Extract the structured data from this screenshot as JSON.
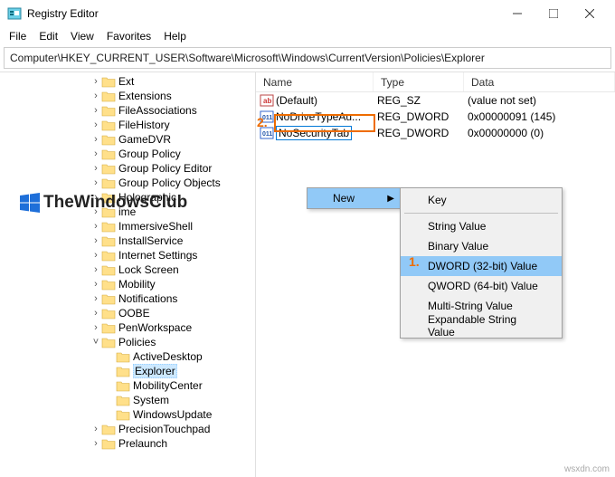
{
  "title": "Registry Editor",
  "menus": {
    "file": "File",
    "edit": "Edit",
    "view": "View",
    "favorites": "Favorites",
    "help": "Help"
  },
  "address": "Computer\\HKEY_CURRENT_USER\\Software\\Microsoft\\Windows\\CurrentVersion\\Policies\\Explorer",
  "tree": [
    "Ext",
    "Extensions",
    "FileAssociations",
    "FileHistory",
    "GameDVR",
    "Group Policy",
    "Group Policy Editor",
    "Group Policy Objects",
    "Holographic",
    "ime",
    "ImmersiveShell",
    "InstallService",
    "Internet Settings",
    "Lock Screen",
    "Mobility",
    "Notifications",
    "OOBE",
    "PenWorkspace",
    "Policies"
  ],
  "policies_sub": [
    "ActiveDesktop",
    "Explorer",
    "MobilityCenter",
    "System",
    "WindowsUpdate"
  ],
  "tree_after": [
    "PrecisionTouchpad",
    "Prelaunch"
  ],
  "selected_tree": "Explorer",
  "columns": {
    "name": "Name",
    "type": "Type",
    "data": "Data"
  },
  "rows": [
    {
      "icon": "sz",
      "name": "(Default)",
      "type": "REG_SZ",
      "data": "(value not set)"
    },
    {
      "icon": "dw",
      "name": "NoDriveTypeAu...",
      "type": "REG_DWORD",
      "data": "0x00000091 (145)"
    },
    {
      "icon": "dw",
      "name": "NoSecurityTab",
      "type": "REG_DWORD",
      "data": "0x00000000 (0)",
      "editing": true
    }
  ],
  "ctx_primary": "New",
  "ctx_secondary": [
    "Key",
    "",
    "String Value",
    "Binary Value",
    "DWORD (32-bit) Value",
    "QWORD (64-bit) Value",
    "Multi-String Value",
    "Expandable String Value"
  ],
  "ctx_selected": "DWORD (32-bit) Value",
  "callouts": {
    "one": "1.",
    "two": "2."
  },
  "watermark": "TheWindowsClub",
  "credit": "wsxdn.com"
}
